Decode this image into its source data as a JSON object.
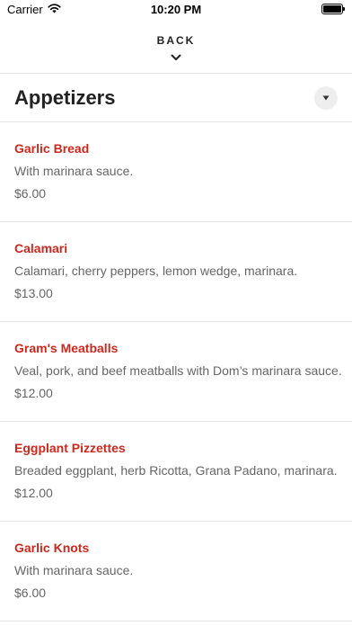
{
  "status_bar": {
    "carrier": "Carrier",
    "time": "10:20 PM"
  },
  "nav": {
    "back_label": "BACK"
  },
  "section": {
    "title": "Appetizers"
  },
  "items": [
    {
      "name": "Garlic Bread",
      "description": "With marinara sauce.",
      "price": "$6.00"
    },
    {
      "name": "Calamari",
      "description": "Calamari, cherry peppers, lemon wedge, marinara.",
      "price": "$13.00"
    },
    {
      "name": "Gram's Meatballs",
      "description": "Veal, pork, and beef meatballs with Dom’s marinara sauce.",
      "price": "$12.00"
    },
    {
      "name": "Eggplant Pizzettes",
      "description": "Breaded eggplant, herb Ricotta, Grana Padano, marinara.",
      "price": "$12.00"
    },
    {
      "name": "Garlic Knots",
      "description": "With marinara sauce.",
      "price": "$6.00"
    }
  ],
  "icons": {
    "wifi": "wifi-icon",
    "battery": "battery-icon",
    "back_chevron": "chevron-down-icon",
    "section_toggle": "caret-down-icon"
  },
  "colors": {
    "accent": "#d0271d",
    "text_secondary": "#666666",
    "divider": "#e6e6e6"
  }
}
